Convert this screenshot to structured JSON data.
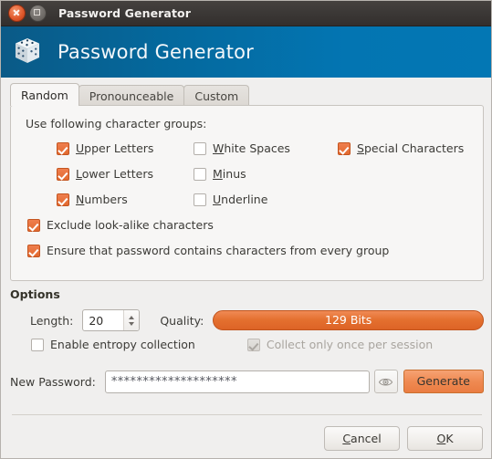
{
  "window": {
    "title": "Password Generator",
    "close_icon": "close-icon",
    "maximize_icon": "maximize-icon"
  },
  "header": {
    "title": "Password Generator",
    "icon": "dice-icon",
    "gradient_start": "#0a5a87",
    "gradient_end": "#0377b4"
  },
  "tabs": [
    {
      "label": "Random",
      "active": true
    },
    {
      "label": "Pronounceable",
      "active": false
    },
    {
      "label": "Custom",
      "active": false
    }
  ],
  "character_groups": {
    "heading": "Use following character groups:",
    "items": [
      {
        "label_pre": "U",
        "label_post": "pper Letters",
        "checked": true,
        "enabled": true,
        "col": 1,
        "row": 1
      },
      {
        "label_pre": "L",
        "label_post": "ower Letters",
        "checked": true,
        "enabled": true,
        "col": 1,
        "row": 2
      },
      {
        "label_pre": "N",
        "label_post": "umbers",
        "checked": true,
        "enabled": true,
        "col": 1,
        "row": 3
      },
      {
        "label_pre": "W",
        "label_post": "hite Spaces",
        "checked": false,
        "enabled": true,
        "col": 2,
        "row": 1
      },
      {
        "label_pre": "M",
        "label_post": "inus",
        "checked": false,
        "enabled": true,
        "col": 2,
        "row": 2
      },
      {
        "label_pre": "U",
        "label_post": "nderline",
        "checked": false,
        "enabled": true,
        "col": 2,
        "row": 3
      },
      {
        "label_pre": "S",
        "label_post": "pecial Characters",
        "checked": true,
        "enabled": true,
        "col": 3,
        "row": 1
      }
    ],
    "exclude_lookalike": {
      "label": "Exclude look-alike characters",
      "checked": true
    },
    "ensure_every_group": {
      "label": "Ensure that password contains characters from every group",
      "checked": true
    }
  },
  "options": {
    "section_title": "Options",
    "length_label": "Length:",
    "length_value": "20",
    "quality_label": "Quality:",
    "quality_text": "129 Bits",
    "quality_percent": 100,
    "quality_color": "#e4702f",
    "enable_entropy": {
      "label": "Enable entropy collection",
      "checked": false,
      "enabled": true
    },
    "collect_once": {
      "label": "Collect only once per session",
      "checked": true,
      "enabled": false
    }
  },
  "password": {
    "label": "New Password:",
    "value": "********************",
    "reveal_icon": "eye-icon",
    "generate_label": "Generate"
  },
  "dialog_buttons": {
    "cancel_pre": "C",
    "cancel_post": "ancel",
    "ok_pre": "O",
    "ok_post": "K"
  }
}
